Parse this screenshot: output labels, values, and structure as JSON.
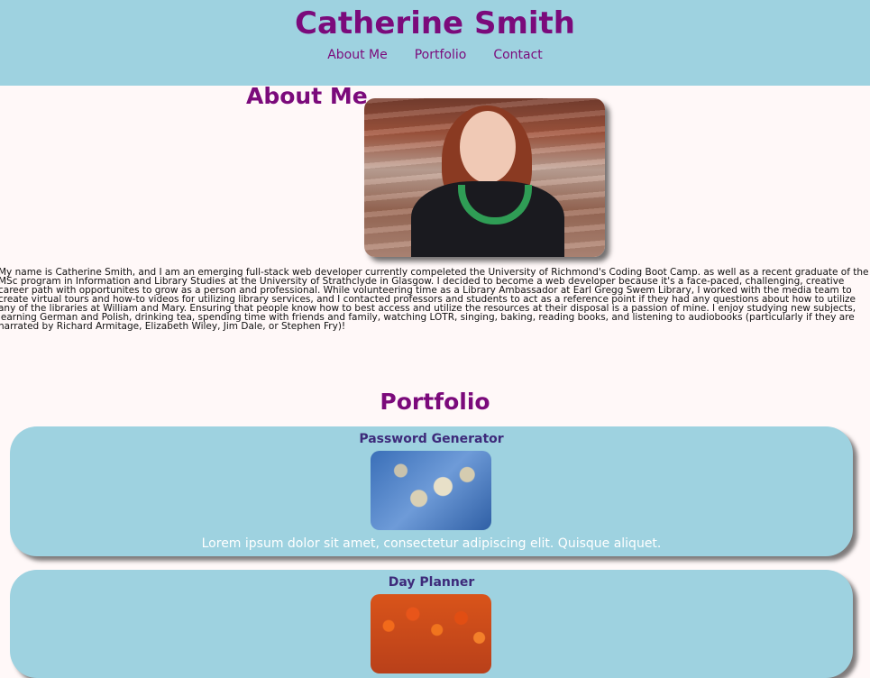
{
  "header": {
    "title": "Catherine Smith",
    "nav": [
      {
        "label": "About Me"
      },
      {
        "label": "Portfolio"
      },
      {
        "label": "Contact"
      }
    ]
  },
  "about": {
    "heading": "About Me",
    "photo_icon": "portrait-photo",
    "text": "My name is Catherine Smith, and I am an emerging full-stack web developer currently compeleted the University of Richmond's Coding Boot Camp. as well as a recent graduate of the MSc program in Information and Library Studies at the University of Strathclyde in Glasgow. I decided to become a web developer because it's a face-paced, challenging, creative career path with opportunites to grow as a person and professional. While volunteering time as a Library Ambassador at Earl Gregg Swem Library, I worked with the media team to create virtual tours and how-to videos for utilizing library services, and I contacted professors and students to act as a reference point if they had any questions about how to utilize any of the libraries at William and Mary. Ensuring that people know how to best access and utilize the resources at their disposal is a passion of mine. I enjoy studying new subjects, learning German and Polish, drinking tea, spending time with friends and family, watching LOTR, singing, baking, reading books, and listening to audiobooks (particularly if they are narrated by Richard Armitage, Elizabeth Wiley, Jim Dale, or Stephen Fry)!"
  },
  "portfolio": {
    "heading": "Portfolio",
    "projects": [
      {
        "title": "Password Generator",
        "image_icon": "pussy-willow-photo",
        "description": "Lorem ipsum dolor sit amet, consectetur adipiscing elit. Quisque aliquet."
      },
      {
        "title": "Day Planner",
        "image_icon": "tulips-photo",
        "description": ""
      }
    ]
  },
  "colors": {
    "header_bg": "#9ed2e0",
    "accent": "#7b0a7b",
    "card_title": "#3d2a7a",
    "page_bg": "#fff8f8"
  }
}
